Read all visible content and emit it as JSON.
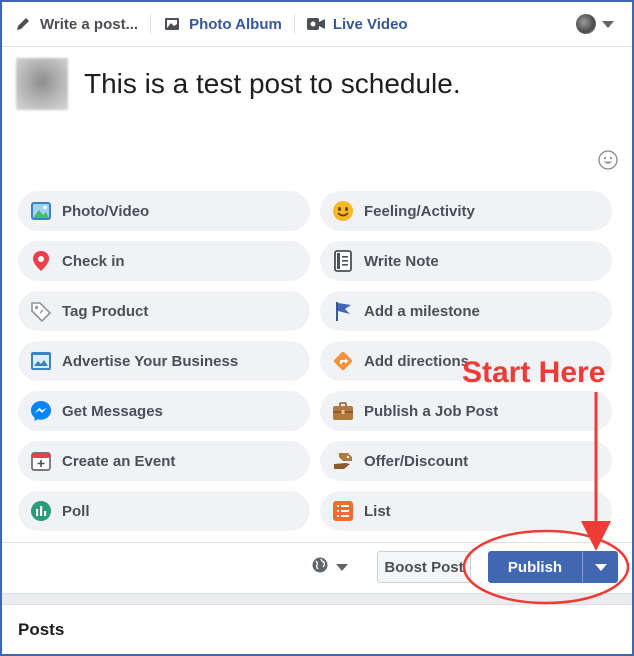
{
  "composer": {
    "tabs": [
      {
        "label": "Write a post...",
        "icon": "pencil-icon"
      },
      {
        "label": "Photo Album",
        "icon": "photo-album-icon"
      },
      {
        "label": "Live Video",
        "icon": "live-video-icon"
      }
    ]
  },
  "post": {
    "text": "This is a test post to schedule."
  },
  "actions": [
    {
      "label": "Photo/Video",
      "icon": "photo-video-icon"
    },
    {
      "label": "Feeling/Activity",
      "icon": "smiley-icon"
    },
    {
      "label": "Check in",
      "icon": "location-pin-icon"
    },
    {
      "label": "Write Note",
      "icon": "note-icon"
    },
    {
      "label": "Tag Product",
      "icon": "tag-icon"
    },
    {
      "label": "Add a milestone",
      "icon": "flag-icon"
    },
    {
      "label": "Advertise Your Business",
      "icon": "advertise-icon"
    },
    {
      "label": "Add directions",
      "icon": "directions-icon"
    },
    {
      "label": "Get Messages",
      "icon": "messenger-icon"
    },
    {
      "label": "Publish a Job Post",
      "icon": "briefcase-icon"
    },
    {
      "label": "Create an Event",
      "icon": "calendar-icon"
    },
    {
      "label": "Offer/Discount",
      "icon": "offer-icon"
    },
    {
      "label": "Poll",
      "icon": "poll-icon"
    },
    {
      "label": "List",
      "icon": "list-icon"
    }
  ],
  "footer": {
    "boost_label": "Boost Post",
    "publish_label": "Publish",
    "privacy_icon": "globe-icon"
  },
  "posts_section": {
    "title": "Posts"
  },
  "annotation": {
    "text": "Start Here",
    "color": "#ef3b35"
  },
  "colors": {
    "brand_blue": "#4267b2",
    "link_blue": "#365899",
    "pill_bg": "#f0f2f5"
  }
}
